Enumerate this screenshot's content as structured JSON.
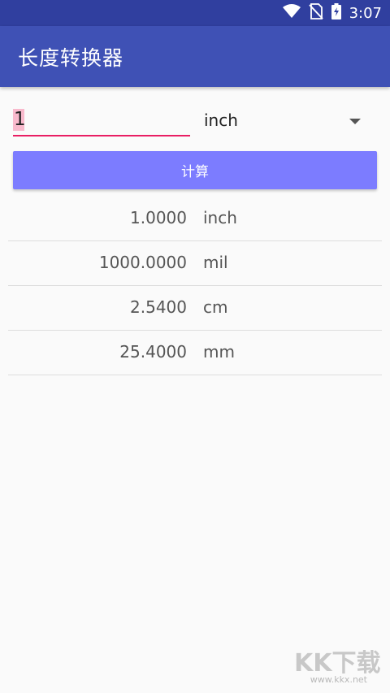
{
  "status_bar": {
    "time": "3:07",
    "icons": [
      "wifi-icon",
      "no-sim-icon",
      "battery-charging-icon"
    ]
  },
  "app_bar": {
    "title": "长度转换器"
  },
  "input": {
    "value": "1"
  },
  "unit_select": {
    "selected": "inch"
  },
  "calc_button": {
    "label": "计算"
  },
  "results": [
    {
      "value": "1.0000",
      "unit": "inch"
    },
    {
      "value": "1000.0000",
      "unit": "mil"
    },
    {
      "value": "2.5400",
      "unit": "cm"
    },
    {
      "value": "25.4000",
      "unit": "mm"
    }
  ],
  "watermark": {
    "text": "KK下载",
    "url": "www.kkx.net"
  },
  "colors": {
    "status_bar": "#303f9f",
    "app_bar": "#3f51b5",
    "accent": "#e91e63",
    "button": "#7c7cff"
  }
}
